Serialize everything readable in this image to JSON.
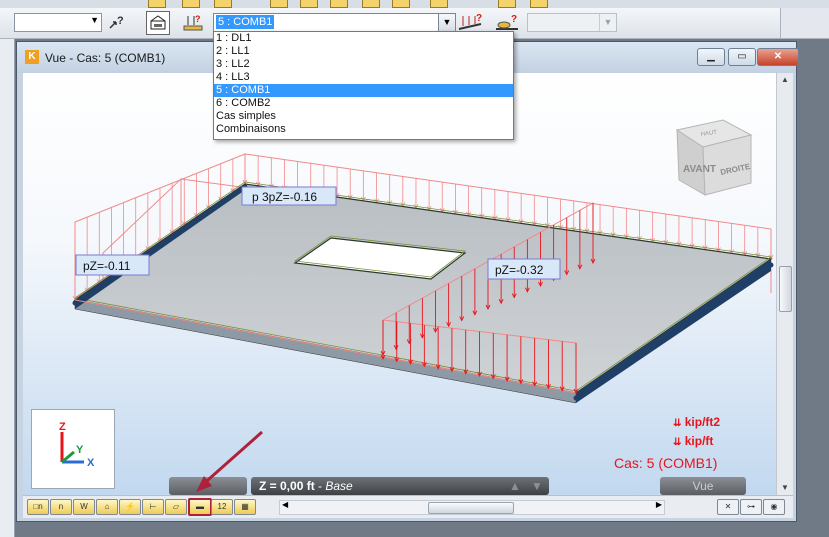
{
  "toolbar": {
    "case_selector_value": "5 : COMB1",
    "icons": [
      "help-cursor-icon",
      "structure-view-icon",
      "load-help-icon",
      "load-display-icon",
      "load-help-2-icon"
    ]
  },
  "dropdown": {
    "items": [
      "1 : DL1",
      "2 : LL1",
      "3 : LL2",
      "4 : LL3",
      "5 : COMB1",
      "6 : COMB2",
      "Cas simples",
      "Combinaisons"
    ],
    "selected_index": 4
  },
  "window": {
    "title": "Vue - Cas: 5 (COMB1)",
    "buttons": [
      "minimize",
      "maximize",
      "close"
    ]
  },
  "viewport": {
    "load_labels": [
      "pZ=-0.11",
      "p 3pZ=-0.16",
      "pZ=-0.32"
    ],
    "view_cube_faces": [
      "AVANT",
      "DROITE",
      "HAUT"
    ],
    "axes": {
      "z": "Z",
      "y": "Y",
      "x": "X"
    },
    "legend": {
      "surface_unit": "kip/ft2",
      "line_unit": "kip/ft",
      "case": "Cas: 5 (COMB1)"
    },
    "status": {
      "z_value": "Z = 0,00 ft",
      "level": "Base",
      "view_button": "Vue"
    }
  },
  "colors": {
    "load_red": "#e8141b",
    "slab_gray": "#c4c8cc",
    "support_blue": "#1f3f66",
    "selection_blue": "#3399ff",
    "annotation_arrow": "#b0203a"
  }
}
